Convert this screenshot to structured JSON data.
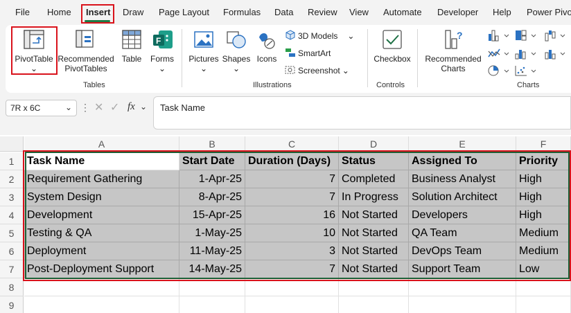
{
  "menu": {
    "tabs": [
      "File",
      "Home",
      "Insert",
      "Draw",
      "Page Layout",
      "Formulas",
      "Data",
      "Review",
      "View",
      "Automate",
      "Developer",
      "Help",
      "Power Pivot"
    ],
    "active": "Insert"
  },
  "ribbon": {
    "tables": {
      "label": "Tables",
      "pivot_table_1": "PivotTable",
      "pivot_table_2": "⌄",
      "recommended_1": "Recommended",
      "recommended_2": "PivotTables",
      "table": "Table",
      "forms_1": "Forms",
      "forms_2": "⌄"
    },
    "illustrations": {
      "label": "Illustrations",
      "pictures_1": "Pictures",
      "pictures_2": "⌄",
      "shapes_1": "Shapes",
      "shapes_2": "⌄",
      "icons": "Icons",
      "models_3d": "3D Models",
      "smartart": "SmartArt",
      "screenshot": "Screenshot"
    },
    "controls": {
      "label": "Controls",
      "checkbox": "Checkbox"
    },
    "charts": {
      "label": "Charts",
      "recommended_1": "Recommended",
      "recommended_2": "Charts"
    }
  },
  "formula_bar": {
    "name_box": "7R x 6C",
    "fx": "fx",
    "value": "Task Name"
  },
  "sheet": {
    "columns": [
      "A",
      "B",
      "C",
      "D",
      "E",
      "F"
    ],
    "rows": [
      "1",
      "2",
      "3",
      "4",
      "5",
      "6",
      "7",
      "8",
      "9"
    ],
    "header": [
      "Task Name",
      "Start Date",
      "Duration (Days)",
      "Status",
      "Assigned To",
      "Priority"
    ],
    "data": [
      [
        "Requirement Gathering",
        "1-Apr-25",
        "7",
        "Completed",
        "Business Analyst",
        "High"
      ],
      [
        "System Design",
        "8-Apr-25",
        "7",
        "In Progress",
        "Solution Architect",
        "High"
      ],
      [
        "Development",
        "15-Apr-25",
        "16",
        "Not Started",
        "Developers",
        "High"
      ],
      [
        "Testing & QA",
        "1-May-25",
        "10",
        "Not Started",
        "QA Team",
        "Medium"
      ],
      [
        "Deployment",
        "11-May-25",
        "3",
        "Not Started",
        "DevOps Team",
        "Medium"
      ],
      [
        "Post-Deployment Support",
        "14-May-25",
        "7",
        "Not Started",
        "Support Team",
        "Low"
      ]
    ]
  },
  "colors": {
    "accent": "#1e7145",
    "highlight_red": "#d9121b",
    "selection_fill": "#c6c6c6"
  }
}
